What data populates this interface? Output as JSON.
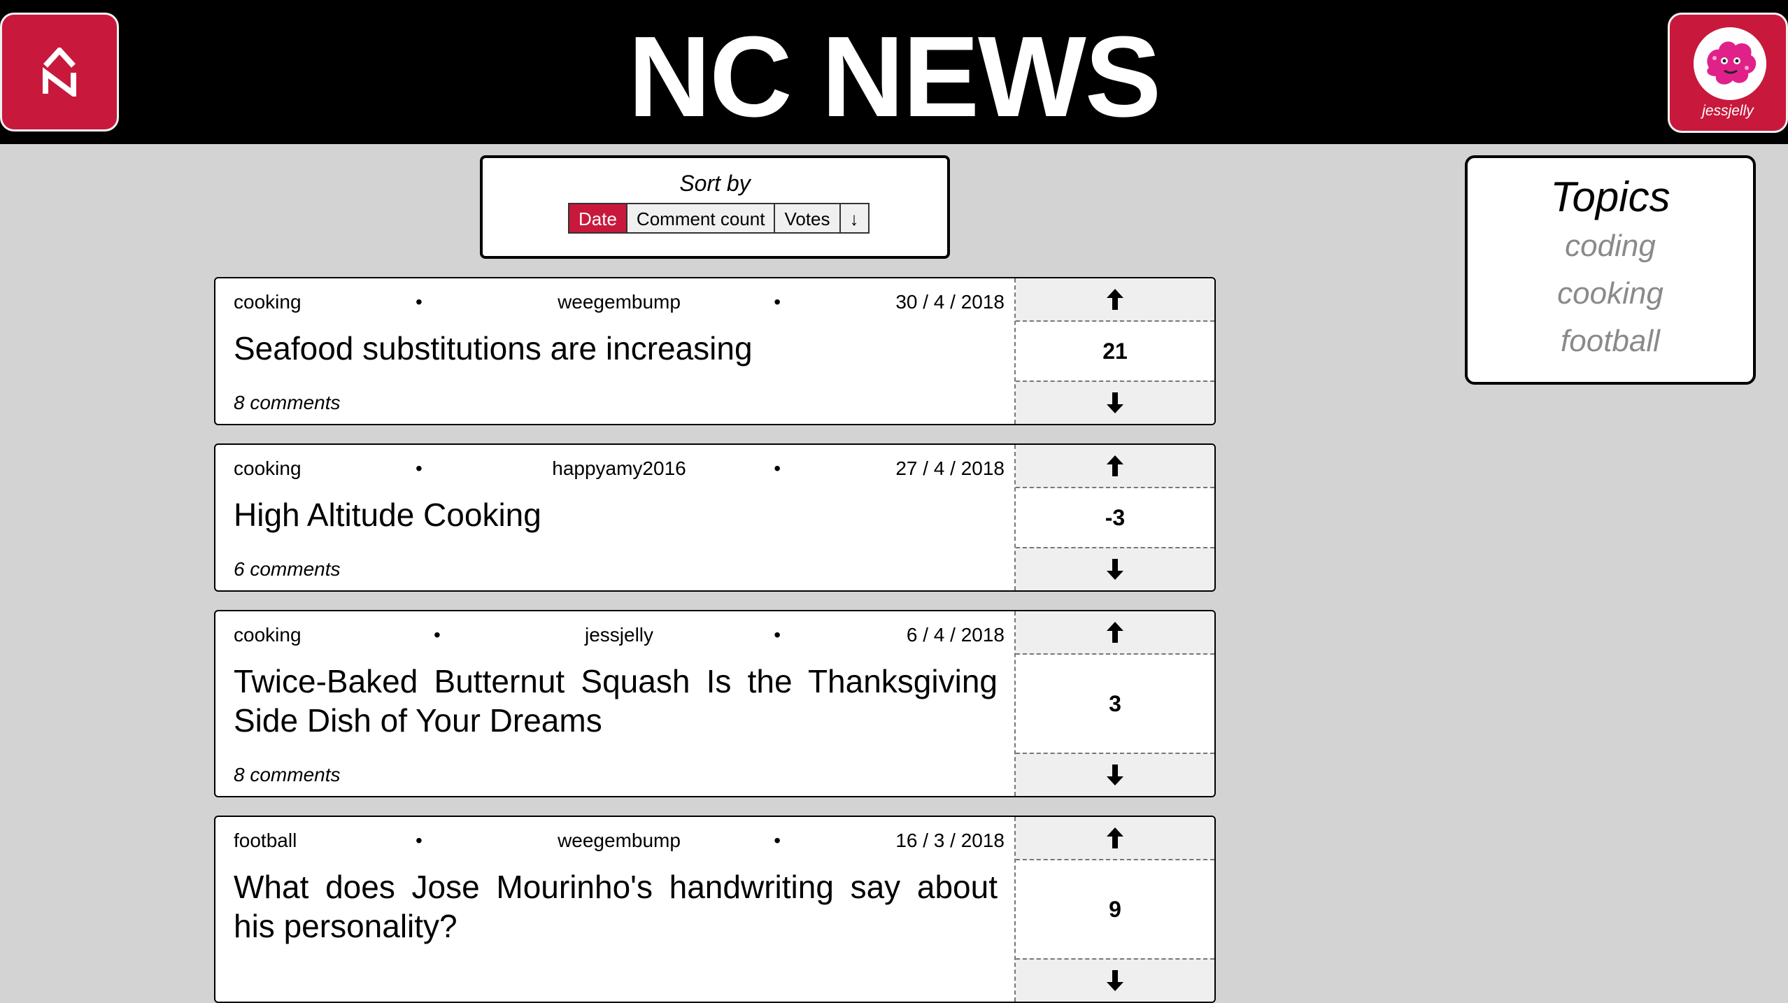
{
  "header": {
    "title": "NC NEWS",
    "logo_icon": "nc-logo-icon",
    "user": {
      "username": "jessjelly",
      "avatar_icon": "jessjelly-avatar"
    }
  },
  "sort": {
    "title": "Sort by",
    "options": [
      "Date",
      "Comment count",
      "Votes"
    ],
    "active": "Date",
    "order_icon": "↓"
  },
  "articles": [
    {
      "topic": "cooking",
      "author": "weegembump",
      "date": "30 / 4 / 2018",
      "title": "Seafood substitutions are increasing",
      "comments": "8 comments",
      "votes": "21"
    },
    {
      "topic": "cooking",
      "author": "happyamy2016",
      "date": "27 / 4 / 2018",
      "title": "High Altitude Cooking",
      "comments": "6 comments",
      "votes": "-3"
    },
    {
      "topic": "cooking",
      "author": "jessjelly",
      "date": "6 / 4 / 2018",
      "title": "Twice-Baked Butternut Squash Is the Thanksgiving Side Dish of Your Dreams",
      "comments": "8 comments",
      "votes": "3"
    },
    {
      "topic": "football",
      "author": "weegembump",
      "date": "16 / 3 / 2018",
      "title": "What does Jose Mourinho's handwriting say about his personality?",
      "comments": "",
      "votes": "9"
    }
  ],
  "topics": {
    "title": "Topics",
    "items": [
      "coding",
      "cooking",
      "football"
    ]
  },
  "colors": {
    "brand_red": "#c8193c",
    "header_bg": "#000000",
    "page_bg": "#d3d3d3"
  }
}
